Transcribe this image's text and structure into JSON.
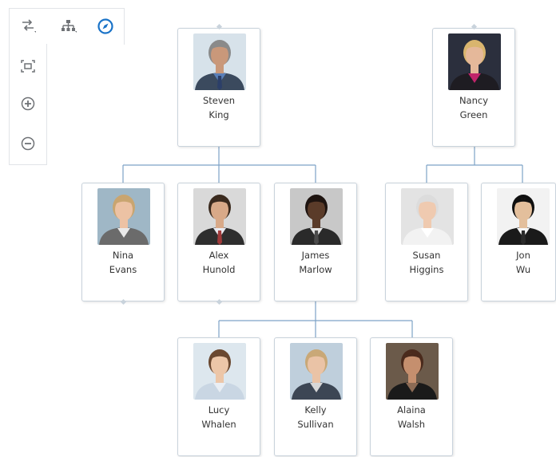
{
  "toolbar": {
    "buttons": [
      {
        "id": "layout",
        "icon": "swap-layout-icon"
      },
      {
        "id": "hierarchy",
        "icon": "org-hierarchy-icon"
      },
      {
        "id": "navigate",
        "icon": "compass-icon"
      },
      {
        "id": "fit",
        "icon": "zoom-to-fit-icon"
      },
      {
        "id": "zoom-in",
        "icon": "zoom-in-icon"
      },
      {
        "id": "zoom-out",
        "icon": "zoom-out-icon"
      }
    ],
    "accent_color": "#1a73c8",
    "icon_color": "#6f7276"
  },
  "nodes": [
    {
      "id": "steven-king",
      "first": "Steven",
      "last": "King",
      "photo": {
        "bg": "#d7e2ea",
        "skin": "#c9987a",
        "hair": "#8a8a8a",
        "suit": "#3b4a5e",
        "shirt": "#5a7fb8",
        "tie": "#2c3f69"
      }
    },
    {
      "id": "nancy-green",
      "first": "Nancy",
      "last": "Green",
      "photo": {
        "bg": "#2b2f3d",
        "skin": "#e5b89a",
        "hair": "#d9b56e",
        "suit": "#1e1c22",
        "shirt": "#c0246a",
        "tie": ""
      }
    },
    {
      "id": "nina-evans",
      "first": "Nina",
      "last": "Evans",
      "photo": {
        "bg": "#9fb7c6",
        "skin": "#ecc2a4",
        "hair": "#c9a570",
        "suit": "#6b6b6b",
        "shirt": "#e9e9e9",
        "tie": ""
      }
    },
    {
      "id": "alex-hunold",
      "first": "Alex",
      "last": "Hunold",
      "photo": {
        "bg": "#d9d9d9",
        "skin": "#d8a988",
        "hair": "#3a2a1e",
        "suit": "#2e2e2e",
        "shirt": "#e9e9ef",
        "tie": "#a03a3a"
      }
    },
    {
      "id": "james-marlow",
      "first": "James",
      "last": "Marlow",
      "photo": {
        "bg": "#c8c8c8",
        "skin": "#5a3b29",
        "hair": "#1e1410",
        "suit": "#2a2a2a",
        "shirt": "#e6e6e6",
        "tie": "#4b4b4b"
      }
    },
    {
      "id": "susan-higgins",
      "first": "Susan",
      "last": "Higgins",
      "photo": {
        "bg": "#e3e3e3",
        "skin": "#efcab0",
        "hair": "#dcdcdc",
        "suit": "#f2f2f2",
        "shirt": "#ffffff",
        "tie": ""
      }
    },
    {
      "id": "jon-wu",
      "first": "Jon",
      "last": "Wu",
      "photo": {
        "bg": "#f2f2f2",
        "skin": "#e3bf9c",
        "hair": "#101010",
        "suit": "#1a1a1a",
        "shirt": "#f5f5f5",
        "tie": "#2a2a2a"
      }
    },
    {
      "id": "lucy-whalen",
      "first": "Lucy",
      "last": "Whalen",
      "photo": {
        "bg": "#dde7ee",
        "skin": "#ecc6a8",
        "hair": "#6a4830",
        "suit": "#c9d6e3",
        "shirt": "#e9eef4",
        "tie": ""
      }
    },
    {
      "id": "kelly-sullivan",
      "first": "Kelly",
      "last": "Sullivan",
      "photo": {
        "bg": "#bfcfdc",
        "skin": "#eac3a6",
        "hair": "#c9a877",
        "suit": "#3c4654",
        "shirt": "#d8d8d8",
        "tie": ""
      }
    },
    {
      "id": "alaina-walsh",
      "first": "Alaina",
      "last": "Walsh",
      "photo": {
        "bg": "#6b5a4a",
        "skin": "#c58f6e",
        "hair": "#4a2a1c",
        "suit": "#1a1a1a",
        "shirt": "#8c6b55",
        "tie": ""
      }
    }
  ],
  "connector_color": "#7da2c6"
}
